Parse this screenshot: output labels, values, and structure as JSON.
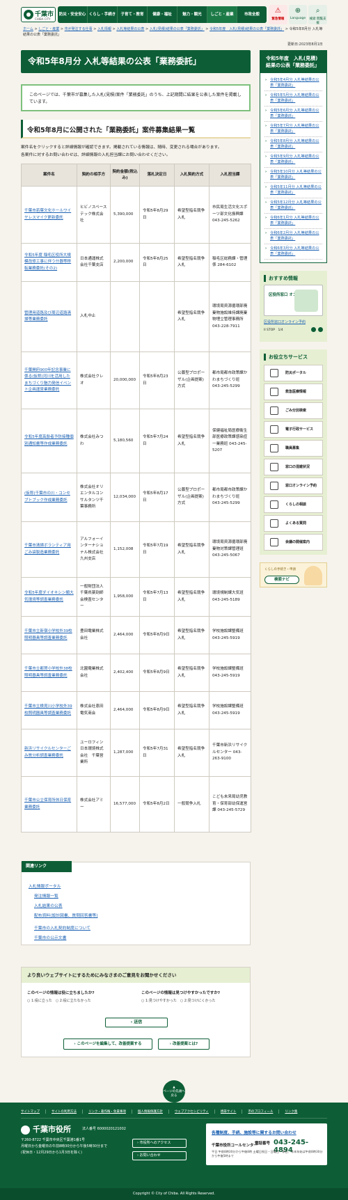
{
  "header": {
    "logo_text": "千葉市",
    "logo_sub": "CHIBA CITY",
    "nav": [
      "防災・安全安心",
      "くらし・手続き",
      "子育て・教育",
      "健康・福祉",
      "魅力・観光",
      "しごと・産業",
      "市政全般"
    ],
    "buttons": [
      "緊急情報",
      "Language",
      "検索 閲覧支援"
    ]
  },
  "breadcrumb": [
    "ホーム",
    "しごと・産業",
    "市が発注する仕事",
    "入札情報",
    "入札等結果の公表",
    "入札(見積)結果の公表「業務委託」",
    "令和5年度　入札(見積)結果の公表「業務委託」",
    "令和5年8月分 入札等結果の公表「業務委託」"
  ],
  "updated": "更新日:2023年8月1日",
  "page_title": "令和5年8月分 入札等結果の公表「業務委託」",
  "intro": "このページでは、千葉市が募集した入札(見積)案件「業務委託」のうち、上記期間に結果を公表した案件を掲載しています。",
  "section_title": "令和5年8月に公開された「業務委託」案件募集結果一覧",
  "desc1": "案件名をクリックすると詳細情報が確認できます。掲載されている情報は、随時、変更される場合があります。",
  "desc2": "各案件に対するお問い合わせは、詳細情報の入札担当課にお問い合わせください。",
  "table": {
    "headers": [
      "案件名",
      "契約の相手方",
      "契約金額(税込み)",
      "落札決定日",
      "入札契約方式",
      "入札担当課"
    ],
    "rows": [
      [
        "千葉市若葉文化ホールワイヤレスマイク更新委託",
        "ヒビノスペーステック株式会社",
        "5,390,000",
        "令和5年8月29日",
        "希望型指名競争入札",
        "市民局生活文化スポーツ部文化振興課 043-245-5262"
      ],
      [
        "令和5年度 稲毛区役所大規模改修工事に伴う什器等移転業務委託(その2)",
        "日本通運株式会社千葉支店",
        "2,200,000",
        "令和5年8月25日",
        "希望型指名競争入札",
        "稲毛区総務課・管理係 284-6102"
      ],
      [
        "管理用道路及び周辺道路清掃等業務委託",
        "入札中止",
        "",
        "",
        "希望型指名競争入札",
        "環境局資源循環部廃棄物施設維持課廃棄物埋立管理事務所 043-228-7911"
      ],
      [
        "千葉開府900年記念事業に係る(仮称)河川を活用したまちづくり魅力発信イベント企画運営業務委託",
        "株式会社クレオ",
        "20,000,000",
        "令和5年8月23日",
        "公募型プロポーザル(企画提案)方式",
        "都市局都市政策課かわまちづくり班 043-245-5299"
      ],
      [
        "令和5年度高齢者予防接種個別通知書等作成業務委託",
        "株式会社みつわ",
        "5,180,560",
        "令和5年7月24日",
        "希望型指名競争入札",
        "保健福祉局医療衛生部医療政策課感染症一業務班 043-245-5207"
      ],
      [
        "(仮称)千葉市の川・コンセプトブック作成業務委託",
        "株式会社オリエンタルコンサルタンツ千葉事務所",
        "12,034,000",
        "令和5年8月17日",
        "公募型プロポーザル(企画提案)方式",
        "都市局都市政策課かわまちづくり班 043-245-5299"
      ],
      [
        "千葉市清掃ボランティア用ごみ袋製造業務委託",
        "アルフォーインターナショナル株式会社九州支店",
        "1,152,008",
        "令和5年7月19日",
        "希望型指名競争入札",
        "環境局資源循環部廃棄物対策課管理班 043-245-5067"
      ],
      [
        "令和5年度ダイオキシン類大気環境等調査業務委託",
        "一般財団法人千葉県薬剤師会検査センター",
        "1,958,000",
        "令和5年7月13日",
        "希望型指名競争入札",
        "環境規制課大気班 043-245-5189"
      ],
      [
        "千葉市立新宿小学校外39校照明器具等調査業務委託",
        "豊田電業株式会社",
        "2,464,000",
        "令和5年8月9日",
        "希望型指名競争入札",
        "学校施設課整備班 043-245-5919"
      ],
      [
        "千葉市立都賀小学校外38校照明器具等調査業務委託",
        "北園電業株式会社",
        "2,402,400",
        "令和5年8月9日",
        "希望型指名競争入札",
        "学校施設課整備班 043-245-5919"
      ],
      [
        "千葉市立検見川小学校外39校照明器具等調査業務委託",
        "株式会社恵田電気商会",
        "2,464,000",
        "令和5年8月9日",
        "希望型指名競争入札",
        "学校施設課整備班 043-245-5919"
      ],
      [
        "新浜リサイクルセンターごみ質分析調査業務委託",
        "ユーロフィン日本環境株式会社　千葉営業所",
        "1,287,000",
        "令和5年7月31日",
        "希望型指名競争入札",
        "千葉市新浜リサイクルセンター 043-263-9100"
      ],
      [
        "千葉市公立保育所休日保育業務委託",
        "株式会社アミー",
        "16,577,000",
        "令和5年8月2日",
        "一般競争入札",
        "こども未来局幼児教育・保育部幼保運営課 043-245-5729"
      ]
    ]
  },
  "related": {
    "title": "関連リンク",
    "items": [
      "入札情報ポータル",
      "発注情報一覧",
      "入札結果の公表",
      "配布資料(設計図書、質問回答書等)",
      "千葉市の入札契約制度について",
      "千葉市の公示文書"
    ]
  },
  "feedback": {
    "title": "より良いウェブサイトにするためにみなさまのご意見をお聞かせください",
    "q1": "このページの情報は役に立ちましたか?",
    "q1_opts": "○ 1:役に立った　○ 2:役に立たなかった",
    "q2": "このページの情報は見つけやすかったですか?",
    "q2_opts": "○ 1:見つけやすかった　○ 2:見つけにくかった",
    "send": "送信",
    "btn_edit": "このページを編集して、改善提案する",
    "btn_what": "改善提案とは?"
  },
  "sidebar": {
    "title": "令和5年度　入札(見積)結果の公表「業務委託」",
    "items": [
      "令和5年4月分 入札等結果の公表「業務委託」",
      "令和5年5月分 入札等結果の公表「業務委託」",
      "令和5年6月分 入札等結果の公表「業務委託」",
      "令和5年7月分 入札等結果の公表「業務委託」",
      "令和5年8月分 入札等結果の公表「業務委託」",
      "令和5年9月分 入札等結果の公表「業務委託」",
      "令和5年10月分 入札等結果の公表「業務委託」",
      "令和5年11月分 入札等結果の公表「業務委託」",
      "令和5年12月分 入札等結果の公表「業務委託」",
      "令和6年1月分 入札等結果の公表「業務委託」",
      "令和6年2月分 入札等結果の公表「業務委託」",
      "令和6年3月分 入札等結果の公表「業務委託」"
    ],
    "osusume_title": "おすすめ情報",
    "banner_text": "区役所窓口 オンライン予約",
    "banner_link": "区役所窓口オンライン予約",
    "slider_ctl": "II STOP　1/4",
    "yaku_title": "お役立ちサービス",
    "services": [
      "防災ポータル",
      "救急医療情報",
      "ごみ分別検索",
      "電子行政サービス",
      "職員募集",
      "窓口の混雑状況",
      "窓口オンライン予約",
      "くらしの相談",
      "よくある質問",
      "会議の開催案内"
    ],
    "navi1": "くらしの手続き・申請",
    "navi2": "検索ナビ"
  },
  "totop": "ページの先頭へ戻る",
  "footer": {
    "links": [
      "サイトマップ",
      "サイトの利用方法",
      "リンク・著作権・免責事項",
      "個人情報保護方針",
      "ウェブアクセシビリティ",
      "携帯サイト",
      "市のプロフィール",
      "リンク集"
    ],
    "office": "千葉市役所",
    "corp_no": "法人番号 6000020121002",
    "address1": "〒260-8722 千葉市中央区千葉港1番1号",
    "address2": "月曜日から金曜日の午前8時30分から午後5時30分まで",
    "address3": "(祝休日・12月29日から1月3日を除く)",
    "btn_access": "市役所へのアクセス",
    "btn_contact": "お問い合わせ",
    "call_title": "各種制度、手続、施設等に関するお問い合わせ",
    "call_center": "千葉市役所コールセンター",
    "tel_label": "電話番号",
    "tel": "043-245-4894",
    "call_hours": "平日 午前8時30分から午後8時 土曜日祝日・日曜日・休日、年末年始は午前8時30分から午後5時まで",
    "copyright": "Copyright © City of Chiba. All Rights Reserved."
  },
  "colors": {
    "primary": "#0d5e36",
    "link": "#1d62b3",
    "bg": "#f6f3ec"
  }
}
